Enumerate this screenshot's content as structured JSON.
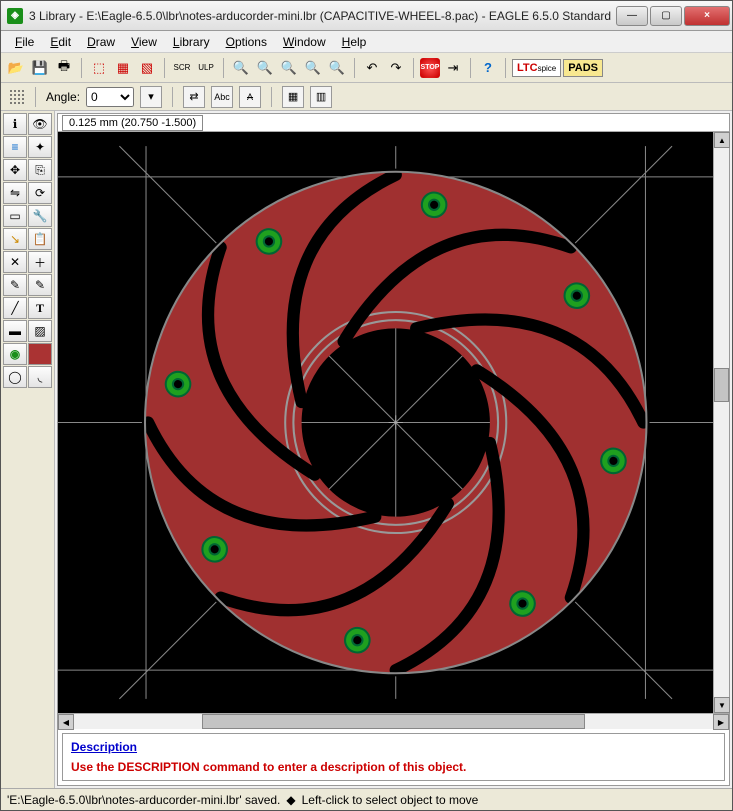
{
  "window": {
    "title": "3 Library - E:\\Eagle-6.5.0\\lbr\\notes-arducorder-mini.lbr (CAPACITIVE-WHEEL-8.pac) - EAGLE 6.5.0 Standard",
    "min": "—",
    "max": "▢",
    "close": "×"
  },
  "menu": {
    "file": "File",
    "edit": "Edit",
    "draw": "Draw",
    "view": "View",
    "library": "Library",
    "options": "Options",
    "window": "Window",
    "help": "Help"
  },
  "toolbar": {
    "ltc_label": "LTC",
    "ltc_sub": "spice",
    "pads_label": "PADS",
    "stop": "STOP"
  },
  "params": {
    "angle_label": "Angle:",
    "angle_value": "0",
    "abc": "Abc"
  },
  "coord": {
    "text": "0.125 mm (20.750 -1.500)"
  },
  "description": {
    "heading": "Description",
    "body": "Use the DESCRIPTION command to enter a description of this object."
  },
  "status": {
    "text": "'E:\\Eagle-6.5.0\\lbr\\notes-arducorder-mini.lbr' saved.",
    "hint": "Left-click to select object to move"
  },
  "colors": {
    "copper": "#a03030",
    "pad": "#1fa01f",
    "grid": "#888888"
  }
}
